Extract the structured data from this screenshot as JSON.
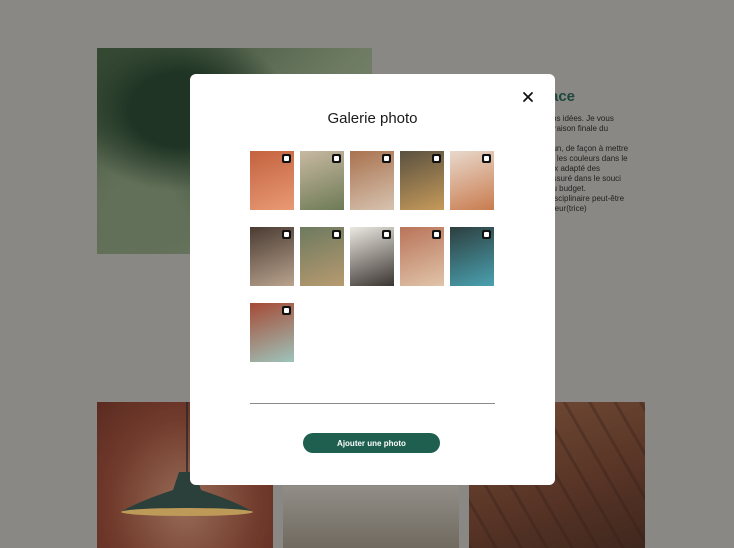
{
  "background": {
    "heading_partial": "ace",
    "text_lines": [
      "vos idées. Je vous",
      "ivraison finale du",
      "",
      "oun, de façon à mettre",
      "et les couleurs dans le",
      "oix adapté des",
      "assuré dans le souci",
      "du budget.",
      "disciplinaire peut-être",
      "ateur(trice)"
    ]
  },
  "modal": {
    "title": "Galerie photo",
    "close_icon": "close-icon",
    "add_photo_label": "Ajouter une photo",
    "accent_color": "#1e5f4f",
    "photos": [
      {
        "name": "lamp-orange",
        "colors": [
          "#c4623f",
          "#e89a74"
        ]
      },
      {
        "name": "living-plants",
        "colors": [
          "#c8b9a2",
          "#6d7a55"
        ]
      },
      {
        "name": "lounge-sofa",
        "colors": [
          "#a9724f",
          "#d7c3b0"
        ]
      },
      {
        "name": "shelf-room",
        "colors": [
          "#5a5140",
          "#c69a5a"
        ]
      },
      {
        "name": "arch-chair",
        "colors": [
          "#e8d9cc",
          "#c97b4e"
        ]
      },
      {
        "name": "dark-bedroom",
        "colors": [
          "#4a3b32",
          "#b9a38e"
        ]
      },
      {
        "name": "green-room",
        "colors": [
          "#6d7a5f",
          "#b79a70"
        ]
      },
      {
        "name": "white-nook",
        "colors": [
          "#ece8e2",
          "#3a3530"
        ]
      },
      {
        "name": "terracotta-room",
        "colors": [
          "#b9745a",
          "#e0c4a9"
        ]
      },
      {
        "name": "bar-counter",
        "colors": [
          "#2d3f3f",
          "#4aa1b0"
        ]
      },
      {
        "name": "corridor-red",
        "colors": [
          "#a54a35",
          "#9ec4bb"
        ]
      }
    ]
  }
}
